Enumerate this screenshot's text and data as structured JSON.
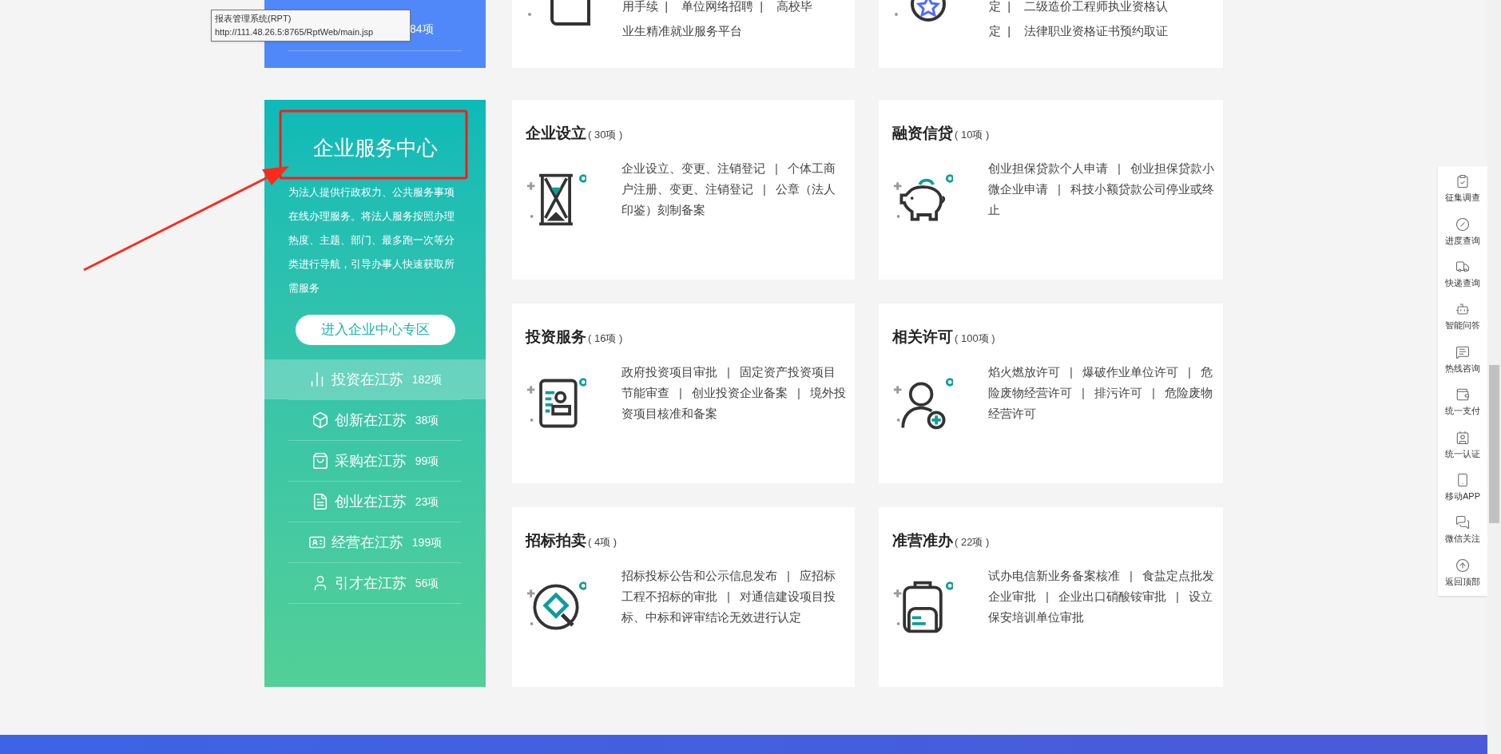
{
  "top_row": {
    "panel_count": "84项",
    "cards": [
      {
        "lines": [
          "用手续  |    单位网络招聘  |    高校毕",
          "业生精准就业服务平台"
        ]
      },
      {
        "lines": [
          "定  |    二级造价工程师执业资格认",
          "定  |    法律职业资格证书预约取证"
        ]
      }
    ]
  },
  "tooltip": {
    "title": "报表管理系统(RPT)",
    "url": "http://111.48.26.5:8765/RptWeb/main.jsp"
  },
  "enterprise_center": {
    "title": "企业服务中心",
    "description": "为法人提供行政权力、公共服务事项在线办理服务。将法人服务按照办理热度、主题、部门、最多跑一次等分类进行导航，引导办事人快速获取所需服务",
    "button": "进入企业中心专区",
    "menu": [
      {
        "label": "投资在江苏",
        "count": "182项",
        "selected": true
      },
      {
        "label": "创新在江苏",
        "count": "38项",
        "selected": false
      },
      {
        "label": "采购在江苏",
        "count": "99项",
        "selected": false
      },
      {
        "label": "创业在江苏",
        "count": "23项",
        "selected": false
      },
      {
        "label": "经营在江苏",
        "count": "199项",
        "selected": false
      },
      {
        "label": "引才在江苏",
        "count": "56项",
        "selected": false
      }
    ]
  },
  "separator": "|",
  "service_cards": [
    {
      "title": "企业设立",
      "count": "( 30项 )",
      "items": [
        "企业设立、变更、注销登记",
        "个体工商户注册、变更、注销登记",
        "公章（法人印鉴）刻制备案"
      ]
    },
    {
      "title": "融资信贷",
      "count": "( 10项 )",
      "items": [
        "创业担保贷款个人申请",
        "创业担保贷款小微企业申请",
        "科技小额贷款公司停业或终止"
      ]
    },
    {
      "title": "投资服务",
      "count": "( 16项 )",
      "items": [
        "政府投资项目审批",
        "固定资产投资项目节能审查",
        "创业投资企业备案",
        "境外投资项目核准和备案"
      ]
    },
    {
      "title": "相关许可",
      "count": "( 100项 )",
      "items": [
        "焰火燃放许可",
        "爆破作业单位许可",
        "危险废物经营许可",
        "排污许可",
        "危险废物经营许可"
      ]
    },
    {
      "title": "招标拍卖",
      "count": "( 4项 )",
      "items": [
        "招标投标公告和公示信息发布",
        "应招标工程不招标的审批",
        "对通信建设项目投标、中标和评审结论无效进行认定"
      ]
    },
    {
      "title": "准营准办",
      "count": "( 22项 )",
      "items": [
        "试办电信新业务备案核准",
        "食盐定点批发企业审批",
        "企业出口硝酸铵审批",
        "设立保安培训单位审批"
      ]
    }
  ],
  "side_toolbar": [
    "征集调查",
    "进度查询",
    "快递查询",
    "智能问答",
    "热线咨询",
    "统一支付",
    "统一认证",
    "移动APP",
    "微信关注",
    "返回顶部"
  ]
}
